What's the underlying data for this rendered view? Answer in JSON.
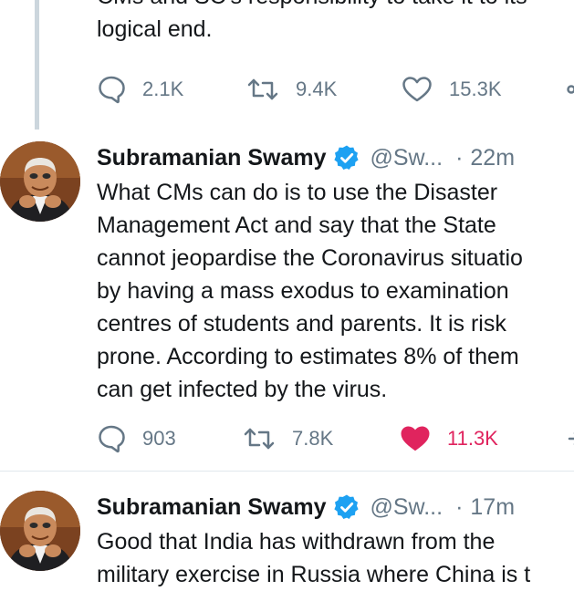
{
  "previous_tweet": {
    "text_lines": [
      "CMs and SC's responsibility to take it to its",
      "logical end."
    ],
    "actions": {
      "replies": "2.1K",
      "retweets": "9.4K",
      "likes": "15.3K"
    }
  },
  "tweets": [
    {
      "author_name": "Subramanian Swamy",
      "handle": "@Sw...",
      "separator": "·",
      "time": "22m",
      "text": "What CMs can do is to use the Disaster\nManagement Act and say that the State\ncannot jeopardise the Coronavirus situatio\nby having a mass exodus to examination\ncentres of students and parents. It is risk\nprone. According to estimates 8% of them\ncan get infected by the virus.",
      "actions": {
        "replies": "903",
        "retweets": "7.8K",
        "likes": "11.3K",
        "liked": true
      }
    },
    {
      "author_name": "Subramanian Swamy",
      "handle": "@Sw...",
      "separator": "·",
      "time": "17m",
      "text": "Good that India has withdrawn from the\nmilitary exercise in Russia where China is t"
    }
  ],
  "icons": {
    "reply": "speech-bubble-icon",
    "retweet": "retweet-arrows-icon",
    "like": "heart-icon",
    "share": "share-icon",
    "verified": "verified-badge-icon"
  },
  "colors": {
    "text": "#14171a",
    "muted": "#657786",
    "verified": "#1da1f2",
    "liked": "#e0245e",
    "thread_line": "#ccd6dd",
    "divider": "#e1e8ed"
  }
}
